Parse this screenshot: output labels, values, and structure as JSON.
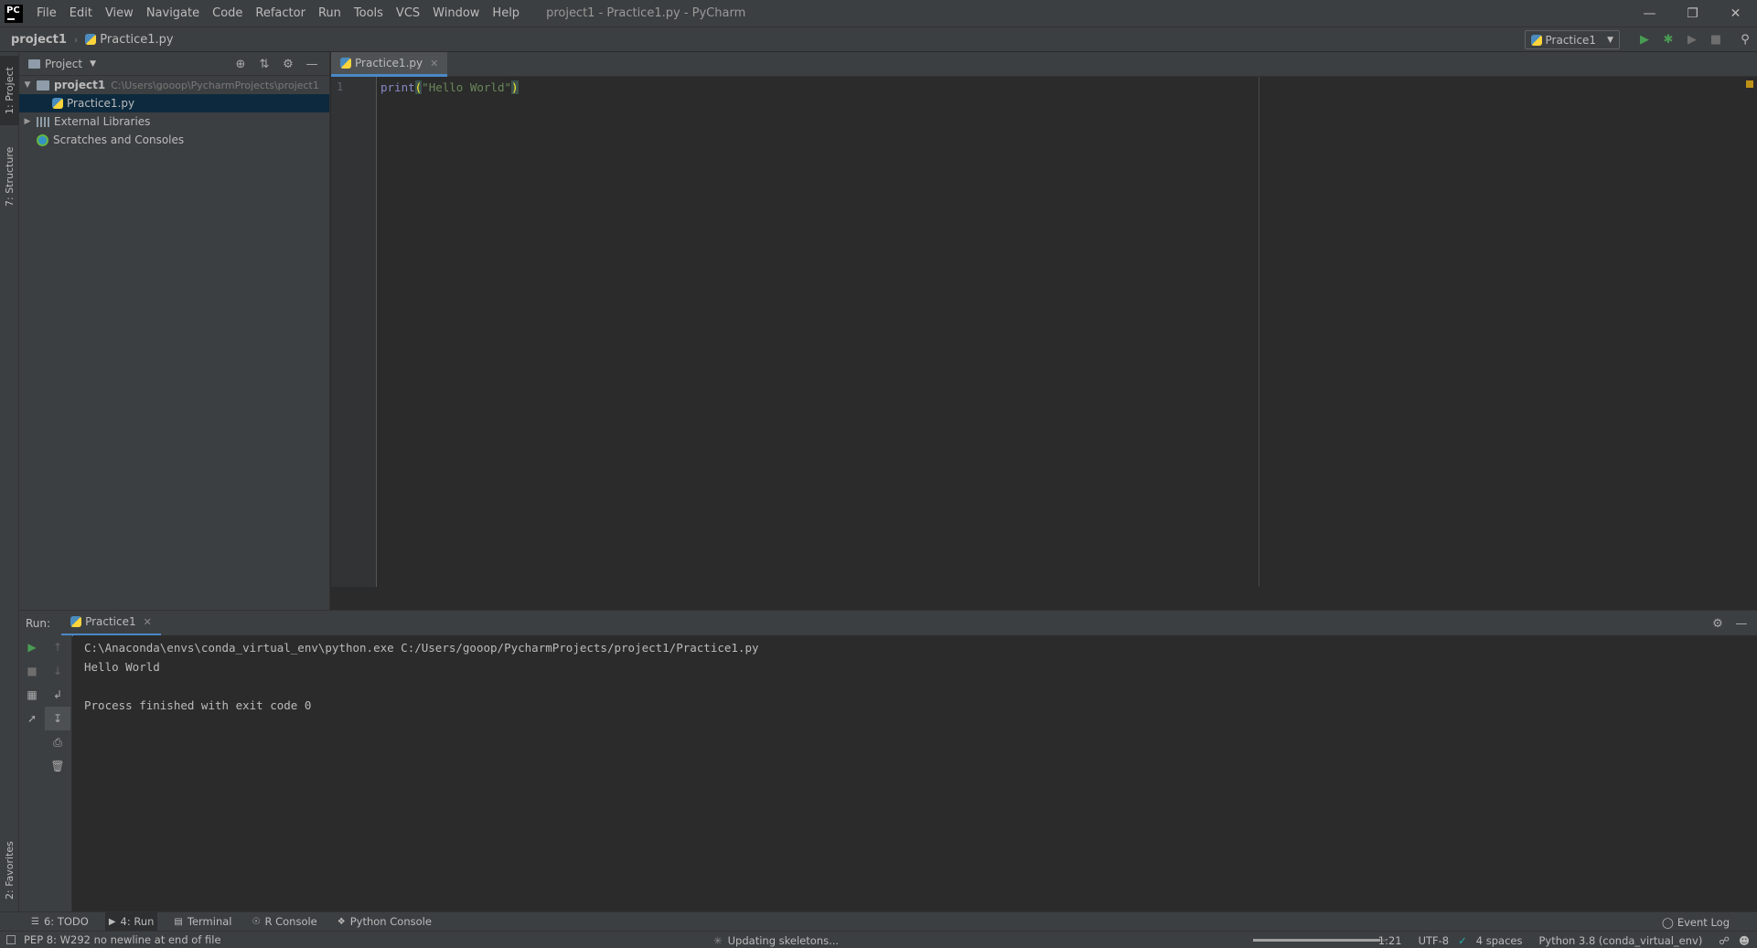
{
  "app": {
    "window_title": "project1 - Practice1.py - PyCharm",
    "logo_text": "PC"
  },
  "menu": [
    "File",
    "Edit",
    "View",
    "Navigate",
    "Code",
    "Refactor",
    "Run",
    "Tools",
    "VCS",
    "Window",
    "Help"
  ],
  "window_controls": [
    "minimize-icon",
    "restore-icon",
    "close-icon"
  ],
  "navbar": {
    "project": "project1",
    "file": "Practice1.py",
    "run_config": "Practice1",
    "icons": [
      "run-icon",
      "debug-icon",
      "coverage-icon",
      "stop-icon",
      "search-icon"
    ]
  },
  "left_stripe": {
    "project_tab": "1: Project",
    "structure_tab": "7: Structure",
    "favorites_tab": "2: Favorites"
  },
  "project_panel": {
    "title": "Project",
    "tree": [
      {
        "label": "project1",
        "path": "C:\\Users\\gooop\\PycharmProjects\\project1",
        "expanded": true,
        "type": "folder"
      },
      {
        "label": "Practice1.py",
        "type": "python-file",
        "selected": true
      },
      {
        "label": "External Libraries",
        "type": "libraries",
        "expanded": false
      },
      {
        "label": "Scratches and Consoles",
        "type": "scratches"
      }
    ]
  },
  "editor": {
    "tab_label": "Practice1.py",
    "line_number": "1",
    "code": {
      "fn": "print",
      "open_paren": "(",
      "string": "\"Hello World\"",
      "close_paren": ")"
    }
  },
  "run_panel": {
    "label": "Run:",
    "tab_label": "Practice1",
    "console_lines": [
      "C:\\Anaconda\\envs\\conda_virtual_env\\python.exe C:/Users/gooop/PycharmProjects/project1/Practice1.py",
      "Hello World",
      "",
      "Process finished with exit code 0"
    ]
  },
  "bottom_tabs": [
    {
      "label": "6: TODO",
      "icon": "todo-icon"
    },
    {
      "label": "4: Run",
      "icon": "run-icon",
      "active": true
    },
    {
      "label": "Terminal",
      "icon": "terminal-icon"
    },
    {
      "label": "R Console",
      "icon": "r-console-icon"
    },
    {
      "label": "Python Console",
      "icon": "python-console-icon"
    }
  ],
  "event_log": "Event Log",
  "status": {
    "message": "PEP 8: W292 no newline at end of file",
    "background_task": "Updating skeletons...",
    "progress": 0.95,
    "position": "1:21",
    "encoding": "UTF-8",
    "indent": "4 spaces",
    "interpreter": "Python 3.8 (conda_virtual_env)"
  },
  "colors": {
    "accent": "#4a88c7",
    "background": "#2b2b2b",
    "panel": "#3c3f41",
    "selection": "#0d293e",
    "run_green": "#499c54"
  }
}
